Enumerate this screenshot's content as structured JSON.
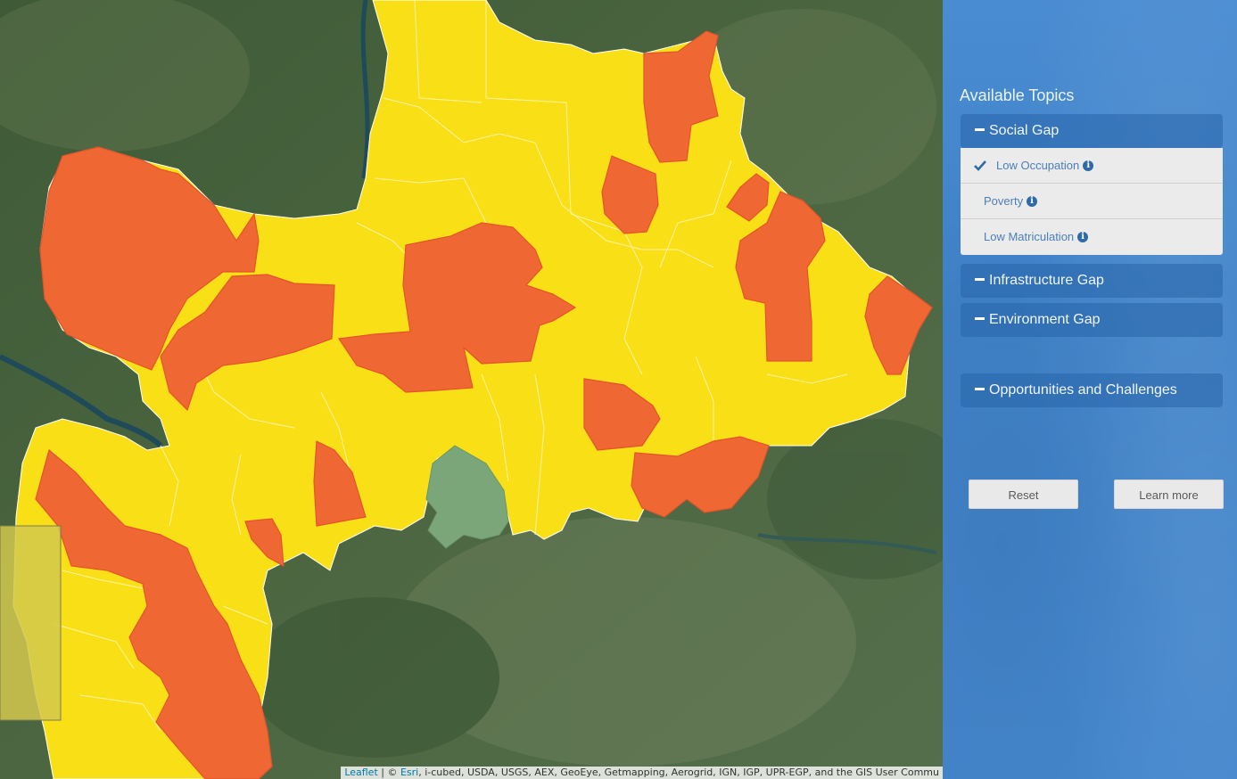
{
  "panel": {
    "title": "Available Topics",
    "topics": [
      {
        "label": "Social Gap",
        "expanded": true
      },
      {
        "label": "Infrastructure Gap"
      },
      {
        "label": "Environment Gap"
      },
      {
        "label": "Opportunities and Challenges"
      }
    ],
    "social_gap_items": [
      {
        "label": "Low Occupation",
        "selected": true,
        "icon": "info-icon"
      },
      {
        "label": "Poverty",
        "selected": false,
        "icon": "info-icon"
      },
      {
        "label": "Low Matriculation",
        "selected": false,
        "icon": "info-icon"
      }
    ],
    "buttons": {
      "reset": "Reset",
      "learn_more": "Learn more"
    }
  },
  "map": {
    "legend_colors": {
      "low": "#f9e016",
      "high": "#ef6733",
      "other": "#7aa67a"
    }
  },
  "attribution": {
    "leaflet": "Leaflet",
    "separator": "| ©",
    "esri": "Esri",
    "text": ", i-cubed, USDA, USGS, AEX, GeoEye, Getmapping, Aerogrid, IGN, IGP, UPR-EGP, and the GIS User Commu"
  }
}
